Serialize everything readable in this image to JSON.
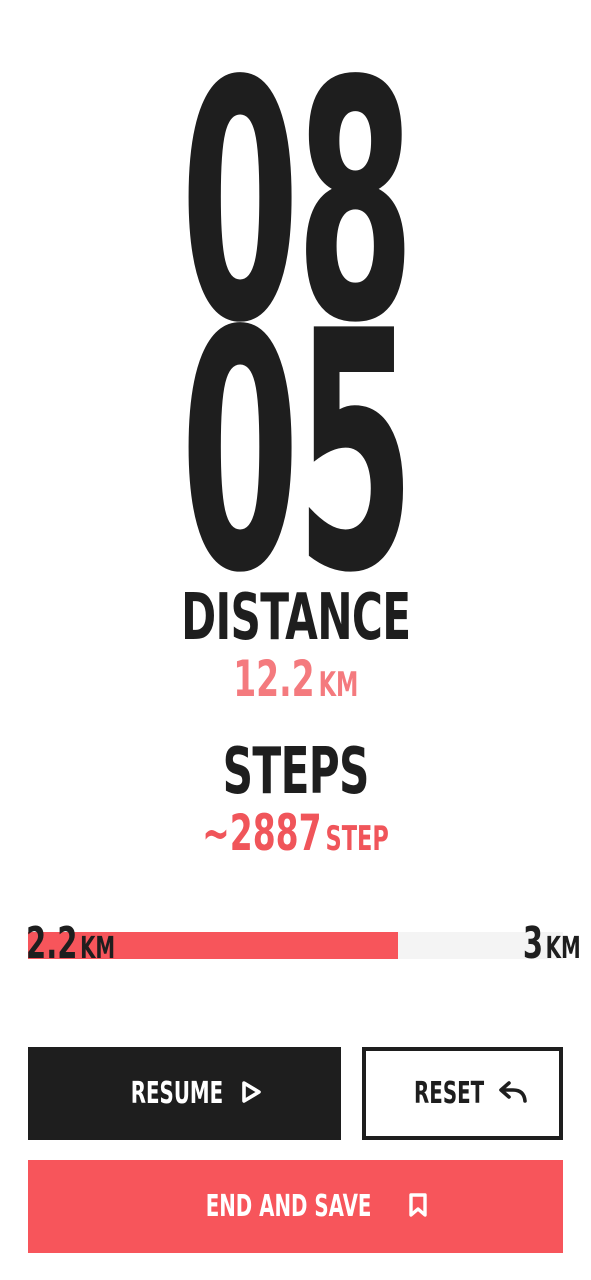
{
  "timer": {
    "minutes": "08",
    "seconds": "05"
  },
  "distance": {
    "label": "DISTANCE",
    "value": "12.2",
    "unit": "KM"
  },
  "steps": {
    "label": "STEPS",
    "value": "~2887",
    "unit": "STEP"
  },
  "progress": {
    "current_value": "2.2",
    "current_unit": "KM",
    "goal_value": "3",
    "goal_unit": "KM",
    "fraction": 0.692
  },
  "buttons": {
    "resume_label": "RESUME",
    "reset_label": "RESET",
    "end_save_label": "END AND SAVE"
  },
  "icons": {
    "resume": "play-icon",
    "reset": "undo-arrow-icon",
    "end_save": "bookmark-icon"
  },
  "colors": {
    "dark": "#1e1e1e",
    "accent": "#f7555b",
    "accent_light": "#f47a7e",
    "track": "#f4f4f4"
  }
}
